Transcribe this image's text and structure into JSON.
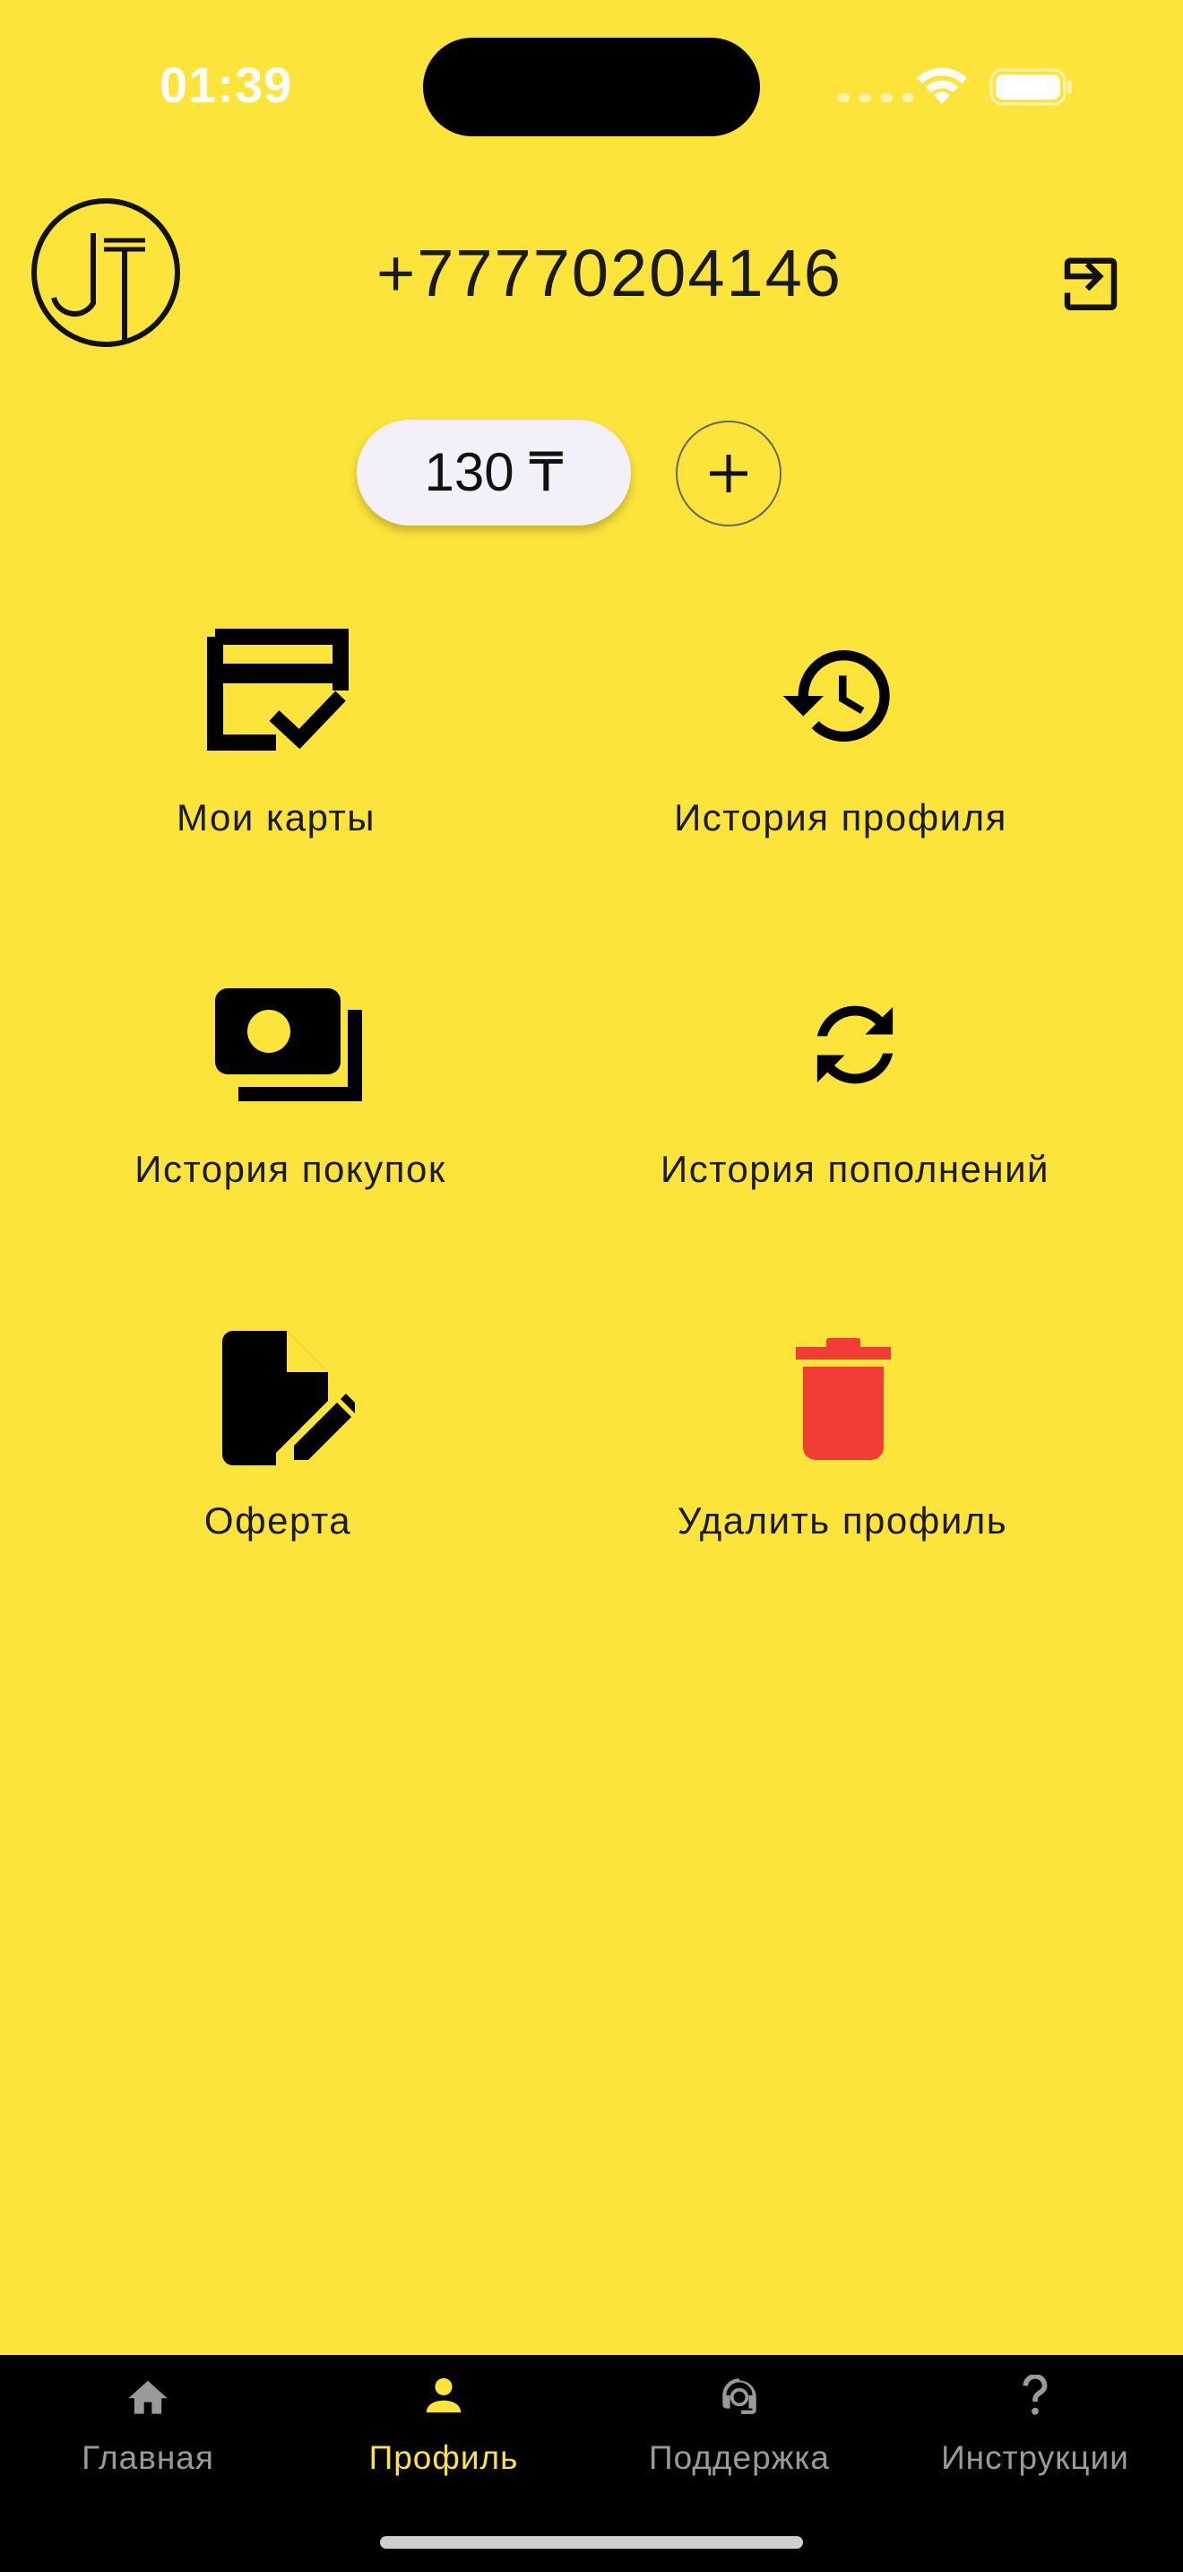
{
  "status": {
    "time": "01:39"
  },
  "header": {
    "phone": "+77770204146"
  },
  "balance": {
    "amount": "130 ₸"
  },
  "menu": [
    {
      "label": "Мои карты",
      "icon": "card-check-icon"
    },
    {
      "label": "История профиля",
      "icon": "history-icon"
    },
    {
      "label": "История покупок",
      "icon": "money-icon"
    },
    {
      "label": "История пополнений",
      "icon": "refresh-icon"
    },
    {
      "label": "Оферта",
      "icon": "document-edit-icon"
    },
    {
      "label": "Удалить профиль",
      "icon": "trash-icon",
      "color": "#F23D36"
    }
  ],
  "nav": [
    {
      "label": "Главная",
      "icon": "home-icon"
    },
    {
      "label": "Профиль",
      "icon": "person-icon",
      "active": true
    },
    {
      "label": "Поддержка",
      "icon": "support-agent-icon"
    },
    {
      "label": "Инструкции",
      "icon": "question-icon"
    }
  ],
  "colors": {
    "background": "#FCE43A",
    "active": "#FCE43A",
    "danger": "#F23D36"
  }
}
